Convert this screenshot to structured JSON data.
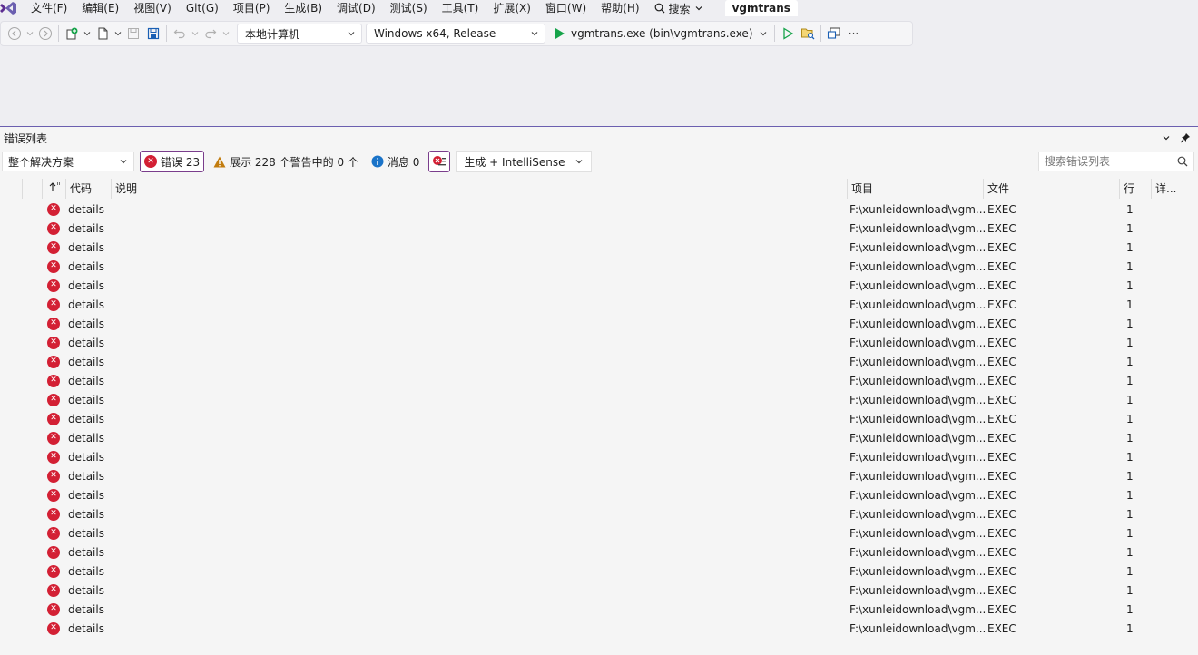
{
  "menu": {
    "items": [
      "文件(F)",
      "编辑(E)",
      "视图(V)",
      "Git(G)",
      "项目(P)",
      "生成(B)",
      "调试(D)",
      "测试(S)",
      "工具(T)",
      "扩展(X)",
      "窗口(W)",
      "帮助(H)"
    ],
    "search_label": "搜索",
    "solution_name": "vgmtrans"
  },
  "toolbar": {
    "target_machine": "本地计算机",
    "configuration": "Windows x64, Release",
    "startup_item": "vgmtrans.exe (bin\\vgmtrans.exe)",
    "more": "···"
  },
  "error_list": {
    "title": "错误列表",
    "scope": "整个解决方案",
    "errors_label": "错误 23",
    "warnings_label": "展示 228 个警告中的 0 个",
    "messages_label": "消息 0",
    "build_source": "生成 + IntelliSense",
    "search_placeholder": "搜索错误列表",
    "columns": {
      "code": "代码",
      "description": "说明",
      "project": "项目",
      "file": "文件",
      "line": "行",
      "details": "详..."
    },
    "rows": [
      {
        "code": "details",
        "description": "",
        "project": "F:\\xunleidownload\\vgm...",
        "file": "EXEC",
        "line": "1"
      },
      {
        "code": "details",
        "description": "",
        "project": "F:\\xunleidownload\\vgm...",
        "file": "EXEC",
        "line": "1"
      },
      {
        "code": "details",
        "description": "",
        "project": "F:\\xunleidownload\\vgm...",
        "file": "EXEC",
        "line": "1"
      },
      {
        "code": "details",
        "description": "",
        "project": "F:\\xunleidownload\\vgm...",
        "file": "EXEC",
        "line": "1"
      },
      {
        "code": "details",
        "description": "",
        "project": "F:\\xunleidownload\\vgm...",
        "file": "EXEC",
        "line": "1"
      },
      {
        "code": "details",
        "description": "",
        "project": "F:\\xunleidownload\\vgm...",
        "file": "EXEC",
        "line": "1"
      },
      {
        "code": "details",
        "description": "",
        "project": "F:\\xunleidownload\\vgm...",
        "file": "EXEC",
        "line": "1"
      },
      {
        "code": "details",
        "description": "",
        "project": "F:\\xunleidownload\\vgm...",
        "file": "EXEC",
        "line": "1"
      },
      {
        "code": "details",
        "description": "",
        "project": "F:\\xunleidownload\\vgm...",
        "file": "EXEC",
        "line": "1"
      },
      {
        "code": "details",
        "description": "",
        "project": "F:\\xunleidownload\\vgm...",
        "file": "EXEC",
        "line": "1"
      },
      {
        "code": "details",
        "description": "",
        "project": "F:\\xunleidownload\\vgm...",
        "file": "EXEC",
        "line": "1"
      },
      {
        "code": "details",
        "description": "",
        "project": "F:\\xunleidownload\\vgm...",
        "file": "EXEC",
        "line": "1"
      },
      {
        "code": "details",
        "description": "",
        "project": "F:\\xunleidownload\\vgm...",
        "file": "EXEC",
        "line": "1"
      },
      {
        "code": "details",
        "description": "",
        "project": "F:\\xunleidownload\\vgm...",
        "file": "EXEC",
        "line": "1"
      },
      {
        "code": "details",
        "description": "",
        "project": "F:\\xunleidownload\\vgm...",
        "file": "EXEC",
        "line": "1"
      },
      {
        "code": "details",
        "description": "",
        "project": "F:\\xunleidownload\\vgm...",
        "file": "EXEC",
        "line": "1"
      },
      {
        "code": "details",
        "description": "",
        "project": "F:\\xunleidownload\\vgm...",
        "file": "EXEC",
        "line": "1"
      },
      {
        "code": "details",
        "description": "",
        "project": "F:\\xunleidownload\\vgm...",
        "file": "EXEC",
        "line": "1"
      },
      {
        "code": "details",
        "description": "",
        "project": "F:\\xunleidownload\\vgm...",
        "file": "EXEC",
        "line": "1"
      },
      {
        "code": "details",
        "description": "",
        "project": "F:\\xunleidownload\\vgm...",
        "file": "EXEC",
        "line": "1"
      },
      {
        "code": "details",
        "description": "",
        "project": "F:\\xunleidownload\\vgm...",
        "file": "EXEC",
        "line": "1"
      },
      {
        "code": "details",
        "description": "",
        "project": "F:\\xunleidownload\\vgm...",
        "file": "EXEC",
        "line": "1"
      },
      {
        "code": "details",
        "description": "",
        "project": "F:\\xunleidownload\\vgm...",
        "file": "EXEC",
        "line": "1"
      }
    ]
  },
  "colors": {
    "accent": "#6b5fb0",
    "error": "#d32034",
    "warning": "#c27c0e",
    "info": "#1a73c8",
    "run": "#16a34a"
  },
  "icons": [
    "vs-logo-icon",
    "back-icon",
    "forward-icon",
    "new-project-icon",
    "open-file-icon",
    "save-icon",
    "save-all-icon",
    "undo-icon",
    "redo-icon",
    "start-icon",
    "start-without-debug-icon",
    "browse-icon",
    "window-icon",
    "search-icon",
    "chevron-down-icon",
    "pin-icon",
    "error-icon",
    "warning-icon",
    "info-icon",
    "filter-icon",
    "sort-arrow-icon"
  ]
}
